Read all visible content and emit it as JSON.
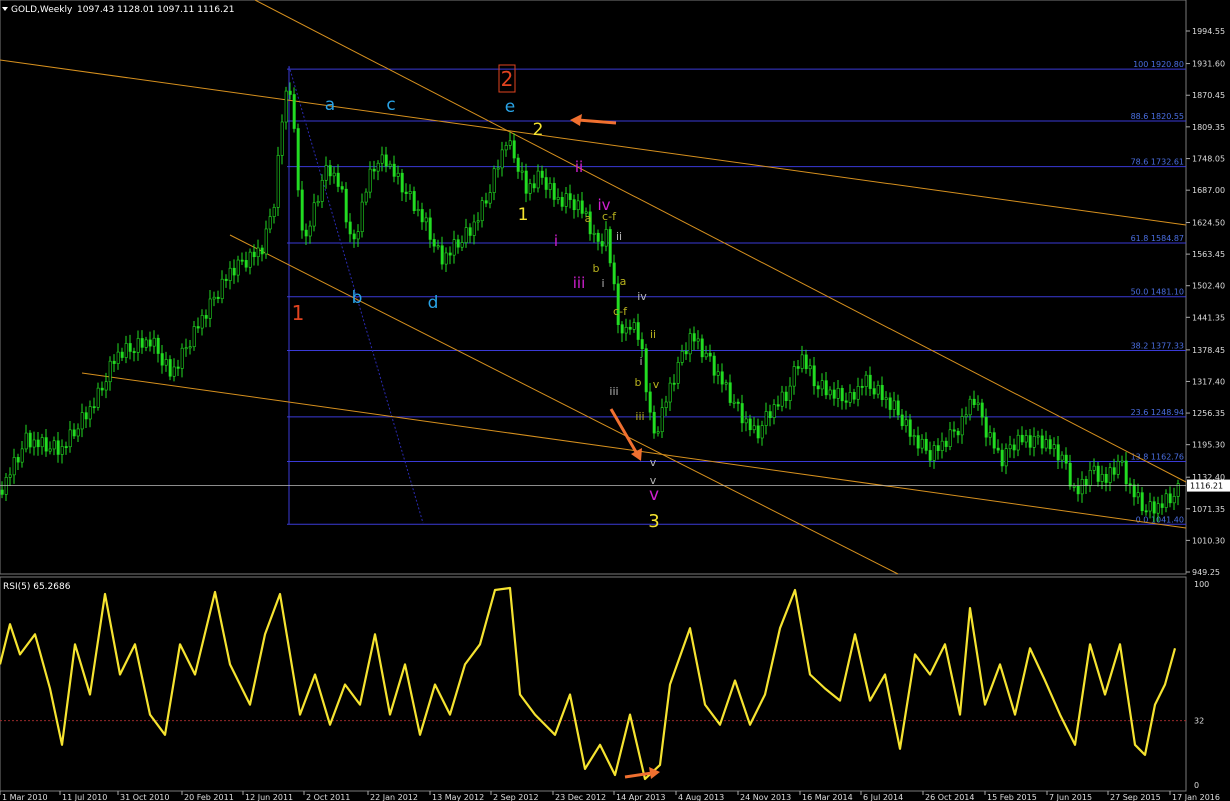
{
  "header": {
    "symbol_label": "GOLD,Weekly",
    "ohlc": "1097.43 1128.01 1097.11 1116.21"
  },
  "price_axis": {
    "ticks": [
      "1994.55",
      "1931.60",
      "1870.45",
      "1809.35",
      "1748.05",
      "1687.00",
      "1624.50",
      "1563.45",
      "1502.40",
      "1441.35",
      "1378.45",
      "1317.40",
      "1256.35",
      "1195.30",
      "1132.40",
      "1071.35",
      "1010.30",
      "949.25"
    ],
    "tick_values": [
      1994.55,
      1931.6,
      1870.45,
      1809.35,
      1748.05,
      1687.0,
      1624.5,
      1563.45,
      1502.4,
      1441.35,
      1378.45,
      1317.4,
      1256.35,
      1195.3,
      1132.4,
      1071.35,
      1010.3,
      949.25
    ],
    "current_price": "1116.21",
    "current_price_value": 1116.21
  },
  "fibonacci": [
    {
      "label": "100 1920.80",
      "value": 1920.8
    },
    {
      "label": "88.6 1820.55",
      "value": 1820.55
    },
    {
      "label": "78.6 1732.61",
      "value": 1732.61
    },
    {
      "label": "61.8 1584.87",
      "value": 1584.87
    },
    {
      "label": "50.0 1481.10",
      "value": 1481.1
    },
    {
      "label": "38.2 1377.33",
      "value": 1377.33
    },
    {
      "label": "23.6 1248.94",
      "value": 1248.94
    },
    {
      "label": "13.8 1162.76",
      "value": 1162.76
    },
    {
      "label": "0.0 1041.40",
      "value": 1041.4
    }
  ],
  "wave_labels": [
    {
      "text": "1",
      "color": "#e0431f",
      "role": "major"
    },
    {
      "text": "2",
      "color": "#e0431f",
      "role": "major-boxed"
    },
    {
      "text": "a",
      "color": "#29a3e6",
      "role": "abcde"
    },
    {
      "text": "b",
      "color": "#29a3e6",
      "role": "abcde"
    },
    {
      "text": "c",
      "color": "#29a3e6",
      "role": "abcde"
    },
    {
      "text": "d",
      "color": "#29a3e6",
      "role": "abcde"
    },
    {
      "text": "e",
      "color": "#29a3e6",
      "role": "abcde"
    },
    {
      "text": "2",
      "color": "#f5e330",
      "role": "intermediate"
    },
    {
      "text": "1",
      "color": "#f5e330",
      "role": "intermediate"
    },
    {
      "text": "3",
      "color": "#f5e330",
      "role": "intermediate"
    },
    {
      "text": "i",
      "color": "#d21fd2",
      "role": "minor"
    },
    {
      "text": "ii",
      "color": "#d21fd2",
      "role": "minor"
    },
    {
      "text": "iii",
      "color": "#d21fd2",
      "role": "minor"
    },
    {
      "text": "iv",
      "color": "#d21fd2",
      "role": "minor"
    },
    {
      "text": "v",
      "color": "#d21fd2",
      "role": "minor"
    },
    {
      "text": "a",
      "color": "#b8b21e",
      "role": "sub"
    },
    {
      "text": "b",
      "color": "#b8b21e",
      "role": "sub"
    },
    {
      "text": "c-f",
      "color": "#b8b21e",
      "role": "sub"
    },
    {
      "text": "ii",
      "color": "#b8b8b8",
      "role": "sub"
    },
    {
      "text": "i",
      "color": "#b8b8b8",
      "role": "sub"
    },
    {
      "text": "a",
      "color": "#b8b21e",
      "role": "sub2"
    },
    {
      "text": "b",
      "color": "#b8b21e",
      "role": "sub2"
    },
    {
      "text": "c-f",
      "color": "#b8b21e",
      "role": "sub2"
    },
    {
      "text": "iv",
      "color": "#b8b8b8",
      "role": "sub2"
    },
    {
      "text": "ii",
      "color": "#b8b21e",
      "role": "sub2"
    },
    {
      "text": "i",
      "color": "#b8b8b8",
      "role": "sub2"
    },
    {
      "text": "iii",
      "color": "#b8b8b8",
      "role": "sub2"
    },
    {
      "text": "iii",
      "color": "#b8b21e",
      "role": "sub2"
    },
    {
      "text": "v",
      "color": "#b8b21e",
      "role": "sub2"
    },
    {
      "text": "v",
      "color": "#b8b8b8",
      "role": "sub2"
    },
    {
      "text": "v",
      "color": "#b8b8b8",
      "role": "sub2"
    }
  ],
  "rsi": {
    "label": "RSI(5) 65.2686",
    "levels": [
      "100",
      "32",
      "0"
    ],
    "level_values": [
      100,
      32,
      0
    ]
  },
  "date_axis": [
    "1 Mar 2010",
    "11 Jul 2010",
    "31 Oct 2010",
    "20 Feb 2011",
    "12 Jun 2011",
    "2 Oct 2011",
    "22 Jan 2012",
    "13 May 2012",
    "2 Sep 2012",
    "23 Dec 2012",
    "14 Apr 2013",
    "4 Aug 2013",
    "24 Nov 2013",
    "16 Mar 2014",
    "6 Jul 2014",
    "26 Oct 2014",
    "15 Feb 2015",
    "7 Jun 2015",
    "27 Sep 2015",
    "17 Jan 2016"
  ],
  "colors": {
    "candle": "#22dd22",
    "fib_line": "#3a3ad6",
    "fib_label": "#4a6ee0",
    "trend_line": "#d6901e",
    "rsi_line": "#f5e330",
    "arrow": "#f07030"
  },
  "chart_data": [
    {
      "type": "line",
      "title": "GOLD,Weekly",
      "ylim": [
        949.25,
        1994.55
      ],
      "x": [
        "1 Mar 2010",
        "11 Jul 2010",
        "31 Oct 2010",
        "20 Feb 2011",
        "12 Jun 2011",
        "2 Oct 2011",
        "22 Jan 2012",
        "13 May 2012",
        "2 Sep 2012",
        "23 Dec 2012",
        "14 Apr 2013",
        "4 Aug 2013",
        "24 Nov 2013",
        "16 Mar 2014",
        "6 Jul 2014",
        "26 Oct 2014",
        "15 Feb 2015",
        "7 Jun 2015",
        "27 Sep 2015",
        "17 Jan 2016"
      ],
      "series": [
        {
          "values": [
            1100,
            1195,
            1345,
            1390,
            1530,
            1660,
            1625,
            1585,
            1720,
            1660,
            1480,
            1320,
            1245,
            1330,
            1315,
            1220,
            1225,
            1175,
            1130,
            1116
          ]
        }
      ]
    },
    {
      "type": "line",
      "title": "RSI(5) 65.2686",
      "ylim": [
        0,
        100
      ],
      "x": [
        "1 Mar 2010",
        "11 Jul 2010",
        "31 Oct 2010",
        "20 Feb 2011",
        "12 Jun 2011",
        "2 Oct 2011",
        "22 Jan 2012",
        "13 May 2012",
        "2 Sep 2012",
        "23 Dec 2012",
        "14 Apr 2013",
        "4 Aug 2013",
        "24 Nov 2013",
        "16 Mar 2014",
        "6 Jul 2014",
        "26 Oct 2014",
        "15 Feb 2015",
        "7 Jun 2015",
        "27 Sep 2015",
        "17 Jan 2016"
      ],
      "series": [
        {
          "values": [
            70,
            88,
            62,
            96,
            94,
            28,
            78,
            30,
            100,
            40,
            5,
            78,
            30,
            78,
            68,
            88,
            45,
            78,
            40,
            65
          ]
        }
      ]
    }
  ]
}
